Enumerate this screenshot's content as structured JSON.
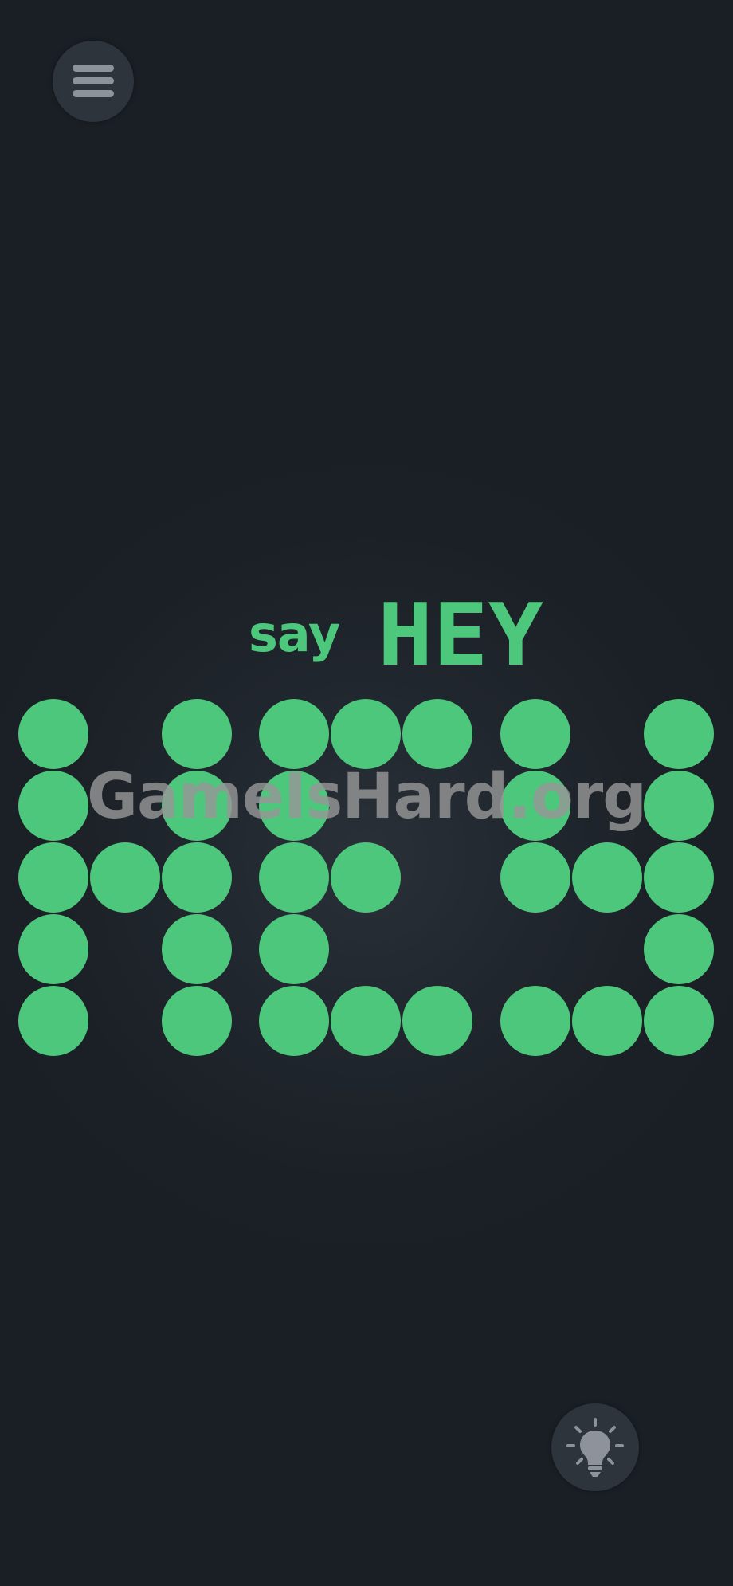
{
  "menu": {
    "icon": "hamburger-menu-icon"
  },
  "title": {
    "prefix": "say",
    "word": "HEY",
    "color": "#4dc77c"
  },
  "watermark": {
    "text": "GameIsHard.org"
  },
  "board": {
    "dot_color": "#4dc77c",
    "rows": [
      "X.X.XXX.X.X",
      "X.X.X...X.X",
      "XXX.XX..XXX",
      "X.X.X.....X",
      "X.X.XXX.XXX"
    ]
  },
  "hint": {
    "icon": "lightbulb-icon"
  }
}
